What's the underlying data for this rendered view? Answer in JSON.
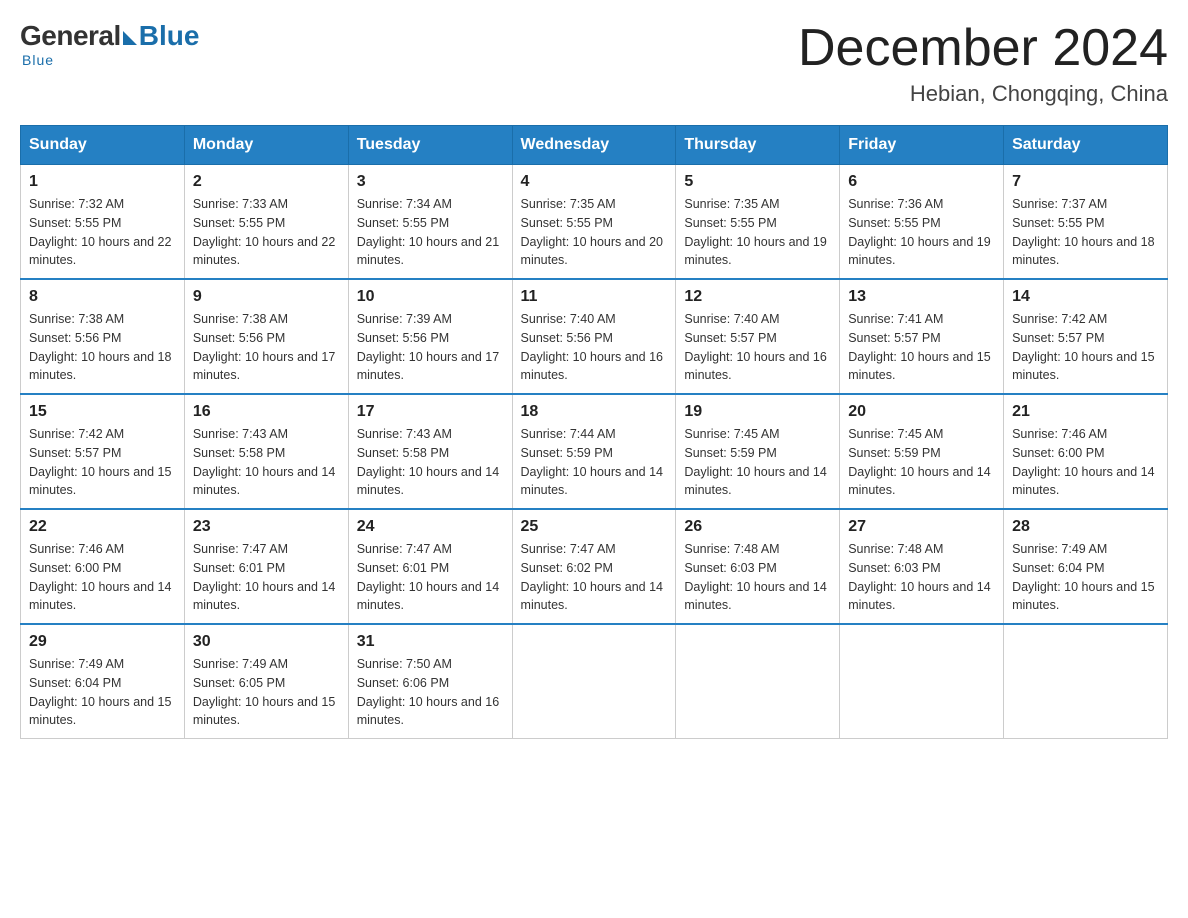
{
  "header": {
    "logo_general": "General",
    "logo_blue": "Blue",
    "month_title": "December 2024",
    "location": "Hebian, Chongqing, China"
  },
  "days_of_week": [
    "Sunday",
    "Monday",
    "Tuesday",
    "Wednesday",
    "Thursday",
    "Friday",
    "Saturday"
  ],
  "weeks": [
    [
      {
        "day": "1",
        "sunrise": "7:32 AM",
        "sunset": "5:55 PM",
        "daylight": "10 hours and 22 minutes."
      },
      {
        "day": "2",
        "sunrise": "7:33 AM",
        "sunset": "5:55 PM",
        "daylight": "10 hours and 22 minutes."
      },
      {
        "day": "3",
        "sunrise": "7:34 AM",
        "sunset": "5:55 PM",
        "daylight": "10 hours and 21 minutes."
      },
      {
        "day": "4",
        "sunrise": "7:35 AM",
        "sunset": "5:55 PM",
        "daylight": "10 hours and 20 minutes."
      },
      {
        "day": "5",
        "sunrise": "7:35 AM",
        "sunset": "5:55 PM",
        "daylight": "10 hours and 19 minutes."
      },
      {
        "day": "6",
        "sunrise": "7:36 AM",
        "sunset": "5:55 PM",
        "daylight": "10 hours and 19 minutes."
      },
      {
        "day": "7",
        "sunrise": "7:37 AM",
        "sunset": "5:55 PM",
        "daylight": "10 hours and 18 minutes."
      }
    ],
    [
      {
        "day": "8",
        "sunrise": "7:38 AM",
        "sunset": "5:56 PM",
        "daylight": "10 hours and 18 minutes."
      },
      {
        "day": "9",
        "sunrise": "7:38 AM",
        "sunset": "5:56 PM",
        "daylight": "10 hours and 17 minutes."
      },
      {
        "day": "10",
        "sunrise": "7:39 AM",
        "sunset": "5:56 PM",
        "daylight": "10 hours and 17 minutes."
      },
      {
        "day": "11",
        "sunrise": "7:40 AM",
        "sunset": "5:56 PM",
        "daylight": "10 hours and 16 minutes."
      },
      {
        "day": "12",
        "sunrise": "7:40 AM",
        "sunset": "5:57 PM",
        "daylight": "10 hours and 16 minutes."
      },
      {
        "day": "13",
        "sunrise": "7:41 AM",
        "sunset": "5:57 PM",
        "daylight": "10 hours and 15 minutes."
      },
      {
        "day": "14",
        "sunrise": "7:42 AM",
        "sunset": "5:57 PM",
        "daylight": "10 hours and 15 minutes."
      }
    ],
    [
      {
        "day": "15",
        "sunrise": "7:42 AM",
        "sunset": "5:57 PM",
        "daylight": "10 hours and 15 minutes."
      },
      {
        "day": "16",
        "sunrise": "7:43 AM",
        "sunset": "5:58 PM",
        "daylight": "10 hours and 14 minutes."
      },
      {
        "day": "17",
        "sunrise": "7:43 AM",
        "sunset": "5:58 PM",
        "daylight": "10 hours and 14 minutes."
      },
      {
        "day": "18",
        "sunrise": "7:44 AM",
        "sunset": "5:59 PM",
        "daylight": "10 hours and 14 minutes."
      },
      {
        "day": "19",
        "sunrise": "7:45 AM",
        "sunset": "5:59 PM",
        "daylight": "10 hours and 14 minutes."
      },
      {
        "day": "20",
        "sunrise": "7:45 AM",
        "sunset": "5:59 PM",
        "daylight": "10 hours and 14 minutes."
      },
      {
        "day": "21",
        "sunrise": "7:46 AM",
        "sunset": "6:00 PM",
        "daylight": "10 hours and 14 minutes."
      }
    ],
    [
      {
        "day": "22",
        "sunrise": "7:46 AM",
        "sunset": "6:00 PM",
        "daylight": "10 hours and 14 minutes."
      },
      {
        "day": "23",
        "sunrise": "7:47 AM",
        "sunset": "6:01 PM",
        "daylight": "10 hours and 14 minutes."
      },
      {
        "day": "24",
        "sunrise": "7:47 AM",
        "sunset": "6:01 PM",
        "daylight": "10 hours and 14 minutes."
      },
      {
        "day": "25",
        "sunrise": "7:47 AM",
        "sunset": "6:02 PM",
        "daylight": "10 hours and 14 minutes."
      },
      {
        "day": "26",
        "sunrise": "7:48 AM",
        "sunset": "6:03 PM",
        "daylight": "10 hours and 14 minutes."
      },
      {
        "day": "27",
        "sunrise": "7:48 AM",
        "sunset": "6:03 PM",
        "daylight": "10 hours and 14 minutes."
      },
      {
        "day": "28",
        "sunrise": "7:49 AM",
        "sunset": "6:04 PM",
        "daylight": "10 hours and 15 minutes."
      }
    ],
    [
      {
        "day": "29",
        "sunrise": "7:49 AM",
        "sunset": "6:04 PM",
        "daylight": "10 hours and 15 minutes."
      },
      {
        "day": "30",
        "sunrise": "7:49 AM",
        "sunset": "6:05 PM",
        "daylight": "10 hours and 15 minutes."
      },
      {
        "day": "31",
        "sunrise": "7:50 AM",
        "sunset": "6:06 PM",
        "daylight": "10 hours and 16 minutes."
      },
      null,
      null,
      null,
      null
    ]
  ]
}
